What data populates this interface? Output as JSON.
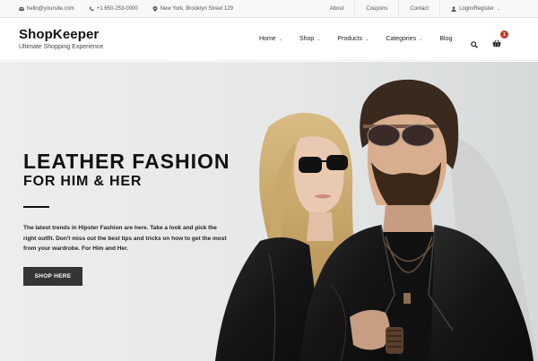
{
  "topbar": {
    "email": "hello@yoursite.com",
    "phone": "+1 650-253-0000",
    "address": "New York, Brooklyn Street 129",
    "links": [
      "About",
      "Coupons",
      "Contact"
    ],
    "account": "Login/Register"
  },
  "header": {
    "logo": "ShopKeeper",
    "tagline": "Ultimate Shopping Experience",
    "nav": [
      "Home",
      "Shop",
      "Products",
      "Categories",
      "Blog"
    ],
    "cart_count": "1"
  },
  "hero": {
    "title": "LEATHER FASHION",
    "subtitle": "FOR HIM & HER",
    "text": "The latest trends in Hipster Fashion are here. Take a look and pick the right outfit. Don't miss out the best tips and tricks on how to get the most from your wardrobe. For Him and Her.",
    "button": "SHOP HERE"
  },
  "colors": {
    "badge": "#c0392b",
    "button": "#353535",
    "hero_bg": "#e9ebeb"
  }
}
